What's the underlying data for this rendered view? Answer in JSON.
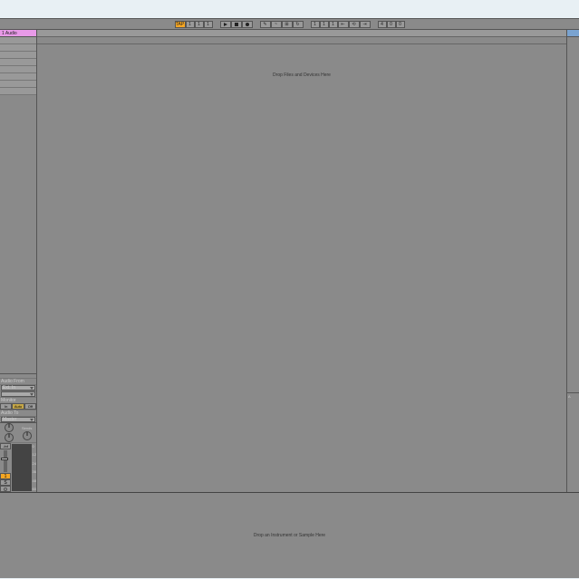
{
  "toolbar": {
    "tap_label": "TAP",
    "position": {
      "bar": "1",
      "beat": "1",
      "sixteenth": "1"
    },
    "loop": {
      "bar": "1",
      "beat": "1",
      "sixteenth": "1"
    },
    "key_sig": {
      "a": "4",
      "b": "0",
      "c": "0"
    }
  },
  "track": {
    "name": "1 Audio",
    "number": "1",
    "io": {
      "audio_from_label": "Audio From",
      "audio_from_value": "Ext. In",
      "monitor_label": "Monitor",
      "monitor_options": [
        "In",
        "Auto",
        "Off"
      ],
      "audio_to_label": "Audio To",
      "audio_to_value": "Master"
    },
    "sends_label": "Sends",
    "vol_display": "-Inf",
    "solo_label": "S",
    "db_marks": [
      "0",
      "12",
      "24",
      "36",
      "48",
      "60"
    ]
  },
  "arrangement": {
    "drop_hint": "Drop Files and Devices Here"
  },
  "right": {
    "label": "A"
  },
  "detail": {
    "hint": "Drop an Instrument or Sample Here"
  }
}
